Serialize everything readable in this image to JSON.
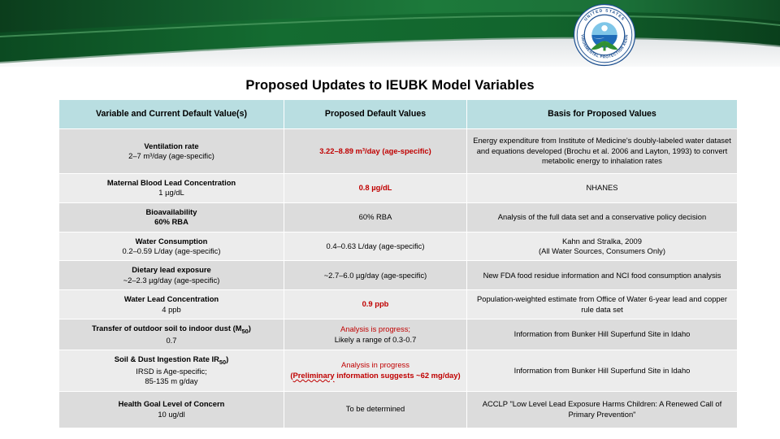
{
  "header": {
    "organization_seal": {
      "icon": "epa-seal-icon",
      "outer_text_top": "UNITED STATES",
      "outer_text_bottom": "ENVIRONMENTAL PROTECTION AGENCY"
    },
    "banner_color_dark": "#0d5a28",
    "banner_color_mid": "#1a7a39",
    "banner_color_light": "#3d9a52"
  },
  "slide": {
    "title": "Proposed Updates to IEUBK Model Variables"
  },
  "table": {
    "columns": [
      "Variable and Current Default Value(s)",
      "Proposed Default Values",
      "Basis for Proposed Values"
    ],
    "rows": [
      {
        "variable_name": "Ventilation rate",
        "variable_current": "2–7 m³/day (age-specific)",
        "proposed": "3.22–8.89 m³/day (age-specific)",
        "proposed_style": "red",
        "basis": "Energy expenditure from Institute of Medicine's doubly-labeled water dataset and equations developed (Brochu et al. 2006 and Layton, 1993) to convert metabolic energy to inhalation rates"
      },
      {
        "variable_name": "Maternal Blood Lead Concentration",
        "variable_current": "1 µg/dL",
        "proposed": "0.8 µg/dL",
        "proposed_style": "red",
        "basis": "NHANES"
      },
      {
        "variable_name": "Bioavailability",
        "variable_current": "60% RBA",
        "variable_current_bold": true,
        "proposed": "60% RBA",
        "proposed_style": "plain",
        "basis": "Analysis of the full data set and a conservative policy decision"
      },
      {
        "variable_name": "Water Consumption",
        "variable_current": "0.2–0.59 L/day (age-specific)",
        "proposed": "0.4–0.63  L/day (age-specific)",
        "proposed_style": "plain",
        "basis_line1": "Kahn and Stralka, 2009",
        "basis_line2": "(All Water Sources, Consumers Only)"
      },
      {
        "variable_name": "Dietary lead exposure",
        "variable_current": "~2–2.3 µg/day (age-specific)",
        "proposed": "~2.7–6.0 µg/day (age-specific)",
        "proposed_style": "plain",
        "basis": "New FDA food residue information and NCI food consumption analysis"
      },
      {
        "variable_name": "Water Lead Concentration",
        "variable_current": "4 ppb",
        "proposed": "0.9 ppb",
        "proposed_style": "red",
        "basis": "Population-weighted estimate from Office of Water 6-year lead and copper rule data set"
      },
      {
        "variable_name": "Transfer of outdoor soil to indoor dust (M",
        "variable_name_sub": "50",
        "variable_name_tail": ")",
        "variable_current": "0.7",
        "proposed_line1": "Analysis is progress;",
        "proposed_line1_style": "red-plain",
        "proposed_line2": "Likely a range of  0.3-0.7",
        "basis": "Information from Bunker Hill Superfund Site in Idaho"
      },
      {
        "variable_name": "Soil & Dust Ingestion Rate IR",
        "variable_name_sub": "50",
        "variable_name_tail": ")",
        "variable_current_line1": "IRSD is Age-specific;",
        "variable_current_line2": "85-135 m g/day",
        "proposed_line1": "Analysis in progress",
        "proposed_line1_style": "red-plain",
        "proposed_line2_prefix": "(",
        "proposed_line2_spellcheck": "Preliminary",
        "proposed_line2_rest": " information suggests ~62 mg/day)",
        "basis": "Information from Bunker Hill Superfund Site in Idaho"
      },
      {
        "variable_name": "Health Goal Level of Concern",
        "variable_current": "10 ug/dl",
        "proposed": "To be determined",
        "proposed_style": "plain",
        "basis": "ACCLP  \"Low Level Lead Exposure Harms Children: A Renewed Call of Primary Prevention\""
      }
    ]
  }
}
